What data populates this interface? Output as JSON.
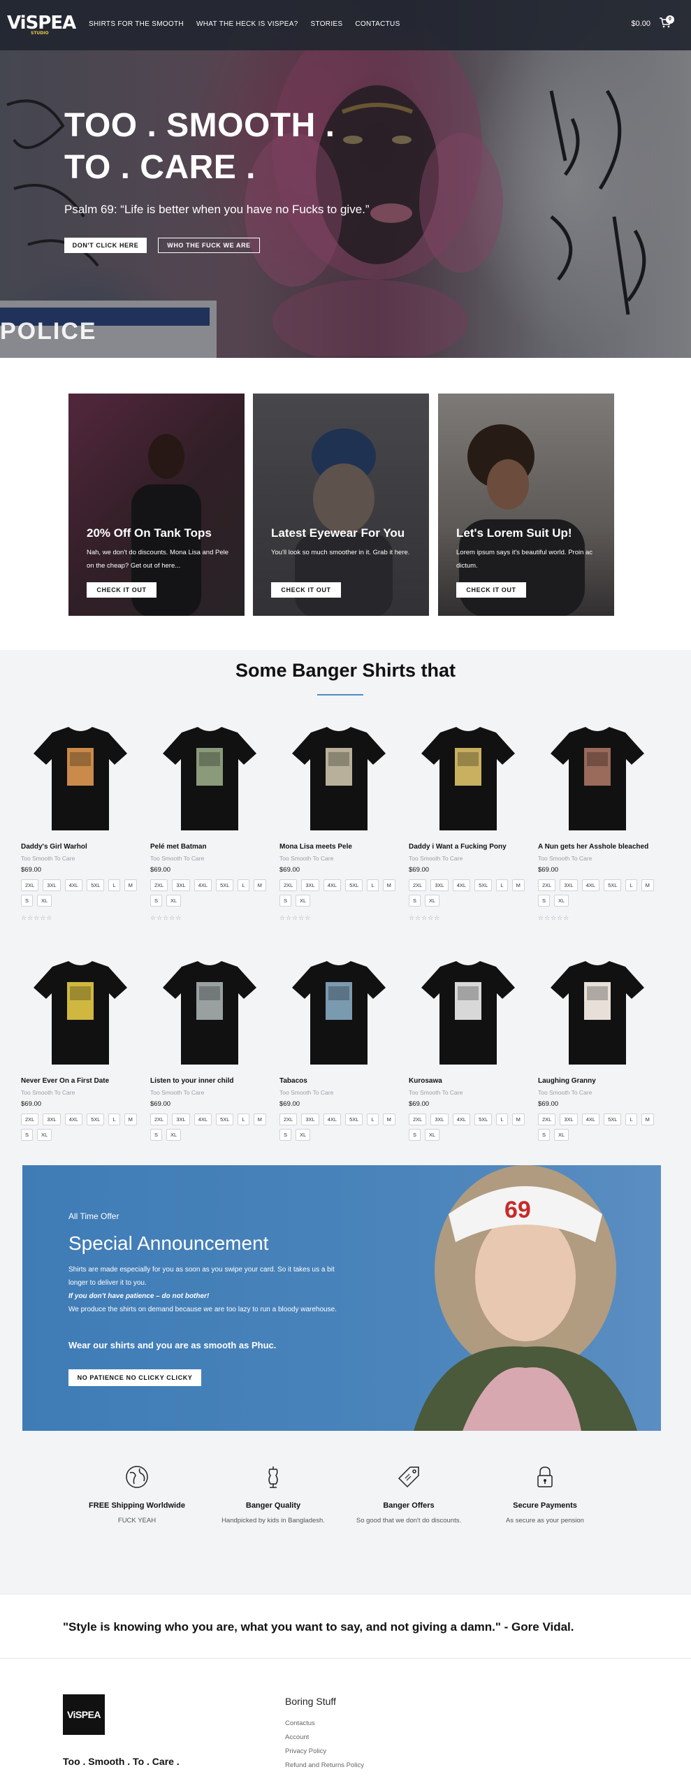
{
  "header": {
    "logo": "ViSPEA",
    "logo_sub": "STUDIO",
    "nav": [
      "SHIRTS FOR THE SMOOTH",
      "WHAT THE HECK IS VISPEA?",
      "STORIES",
      "CONTACTUS"
    ],
    "cart_total": "$0.00",
    "cart_count": "0"
  },
  "hero": {
    "title_line1": "TOO . SMOOTH .",
    "title_line2": "TO . CARE .",
    "subtitle": "Psalm 69: “Life is better when you have no Fucks to give.”",
    "button_primary": "DON'T CLICK HERE",
    "button_secondary": "WHO THE FUCK WE ARE",
    "background_text": "POLICE"
  },
  "promos": [
    {
      "title": "20% Off On Tank Tops",
      "text": "Nah, we don't do discounts. Mona Lisa and Pele on the cheap? Get out of here...",
      "button": "CHECK IT OUT",
      "bg": "#6b3f52"
    },
    {
      "title": "Latest Eyewear For You",
      "text": "You'll look so much smoother in it. Grab it here.",
      "button": "CHECK IT OUT",
      "bg": "#5c5a60"
    },
    {
      "title": "Let's Lorem Suit Up!",
      "text": "Lorem ipsum says it's beautiful world. Proin ac dictum.",
      "button": "CHECK IT OUT",
      "bg": "#8b8480"
    }
  ],
  "shirts": {
    "title": "Some Banger Shirts that",
    "products": [
      {
        "name": "Daddy's Girl Warhol",
        "brand": "Too Smooth To Care",
        "price": "$69.00",
        "sizes": [
          "2XL",
          "3XL",
          "4XL",
          "5XL",
          "L",
          "M",
          "S",
          "XL"
        ],
        "print": "#c98a4a",
        "rating": "☆☆☆☆☆"
      },
      {
        "name": "Pelé met Batman",
        "brand": "Too Smooth To Care",
        "price": "$69.00",
        "sizes": [
          "2XL",
          "3XL",
          "4XL",
          "5XL",
          "L",
          "M",
          "S",
          "XL"
        ],
        "print": "#8a9a7a",
        "rating": "☆☆☆☆☆"
      },
      {
        "name": "Mona Lisa meets Pele",
        "brand": "Too Smooth To Care",
        "price": "$69.00",
        "sizes": [
          "2XL",
          "3XL",
          "4XL",
          "5XL",
          "L",
          "M",
          "S",
          "XL"
        ],
        "print": "#b8b09a",
        "rating": "☆☆☆☆☆"
      },
      {
        "name": "Daddy i Want a Fucking Pony",
        "brand": "Too Smooth To Care",
        "price": "$69.00",
        "sizes": [
          "2XL",
          "3XL",
          "4XL",
          "5XL",
          "L",
          "M",
          "S",
          "XL"
        ],
        "print": "#c8b060",
        "rating": "☆☆☆☆☆"
      },
      {
        "name": "A Nun gets her Asshole bleached",
        "brand": "Too Smooth To Care",
        "price": "$69.00",
        "sizes": [
          "2XL",
          "3XL",
          "4XL",
          "5XL",
          "L",
          "M",
          "S",
          "XL"
        ],
        "print": "#9a6a5a",
        "rating": "☆☆☆☆☆"
      },
      {
        "name": "Never Ever On a First Date",
        "brand": "Too Smooth To Care",
        "price": "$69.00",
        "sizes": [
          "2XL",
          "3XL",
          "4XL",
          "5XL",
          "L",
          "M",
          "S",
          "XL"
        ],
        "print": "#d0b840"
      },
      {
        "name": "Listen to your inner child",
        "brand": "Too Smooth To Care",
        "price": "$69.00",
        "sizes": [
          "2XL",
          "3XL",
          "4XL",
          "5XL",
          "L",
          "M",
          "S",
          "XL"
        ],
        "print": "#9aa0a0"
      },
      {
        "name": "Tabacos",
        "brand": "Too Smooth To Care",
        "price": "$69.00",
        "sizes": [
          "2XL",
          "3XL",
          "4XL",
          "5XL",
          "L",
          "M",
          "S",
          "XL"
        ],
        "print": "#7a9ab0"
      },
      {
        "name": "Kurosawa",
        "brand": "Too Smooth To Care",
        "price": "$69.00",
        "sizes": [
          "2XL",
          "3XL",
          "4XL",
          "5XL",
          "L",
          "M",
          "S",
          "XL"
        ],
        "print": "#d8d8d8"
      },
      {
        "name": "Laughing Granny",
        "brand": "Too Smooth To Care",
        "price": "$69.00",
        "sizes": [
          "2XL",
          "3XL",
          "4XL",
          "5XL",
          "L",
          "M",
          "S",
          "XL"
        ],
        "print": "#e8e0d8"
      }
    ]
  },
  "announcement": {
    "eyebrow": "All Time Offer",
    "title": "Special Announcement",
    "line1": "Shirts are made especially for you as soon as you swipe your card. So it takes us a bit longer to deliver it to you.",
    "line2": "If you don't have patience – do not bother!",
    "line3": "We produce the shirts on demand because we are too lazy to run a bloody warehouse.",
    "tagline": "Wear our shirts and you are as smooth as Phuc.",
    "button": "NO PATIENCE NO CLICKY CLICKY",
    "cap_text": "69"
  },
  "features": [
    {
      "title": "FREE Shipping Worldwide",
      "desc": "FUCK YEAH",
      "icon": "globe-icon"
    },
    {
      "title": "Banger Quality",
      "desc": "Handpicked by kids in Bangladesh.",
      "icon": "dress-form-icon"
    },
    {
      "title": "Banger Offers",
      "desc": "So good that we don't do discounts.",
      "icon": "price-tag-icon"
    },
    {
      "title": "Secure Payments",
      "desc": "As secure as your pension",
      "icon": "padlock-icon"
    }
  ],
  "quote": "\"Style is knowing who you are, what you want to say, and not giving a damn.\" - Gore Vidal.",
  "footer": {
    "logo": "ViSPEA",
    "tagline": "Too . Smooth . To . Care .",
    "links_title": "Boring Stuff",
    "links": [
      "Contactus",
      "Account",
      "Privacy Policy",
      "Refund and Returns Policy"
    ]
  }
}
